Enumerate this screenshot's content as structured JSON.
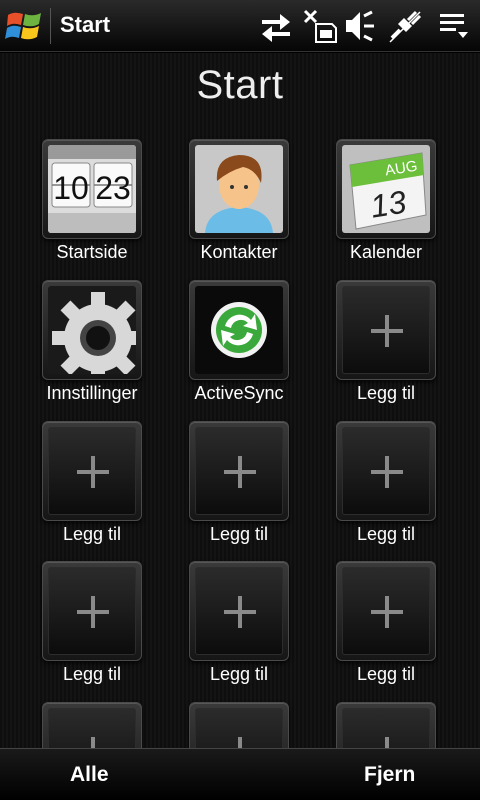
{
  "titlebar": {
    "title": "Start",
    "icons": [
      "windows-start-icon",
      "sync-arrows-icon",
      "no-sim-icon",
      "volume-off-icon",
      "usb-plug-icon",
      "menu-icon"
    ]
  },
  "main": {
    "heading": "Start",
    "tiles": [
      {
        "label": "Startside",
        "icon": "clock-flip-icon",
        "time_hours": "10",
        "time_minutes": "23"
      },
      {
        "label": "Kontakter",
        "icon": "contact-person-icon"
      },
      {
        "label": "Kalender",
        "icon": "calendar-icon",
        "month": "AUG",
        "day": "13"
      },
      {
        "label": "Innstillinger",
        "icon": "gear-icon"
      },
      {
        "label": "ActiveSync",
        "icon": "activesync-icon"
      },
      {
        "label": "Legg til",
        "icon": "plus-icon"
      },
      {
        "label": "Legg til",
        "icon": "plus-icon"
      },
      {
        "label": "Legg til",
        "icon": "plus-icon"
      },
      {
        "label": "Legg til",
        "icon": "plus-icon"
      },
      {
        "label": "Legg til",
        "icon": "plus-icon"
      },
      {
        "label": "Legg til",
        "icon": "plus-icon"
      },
      {
        "label": "Legg til",
        "icon": "plus-icon"
      }
    ]
  },
  "bottombar": {
    "left_label": "Alle",
    "right_label": "Fjern"
  }
}
